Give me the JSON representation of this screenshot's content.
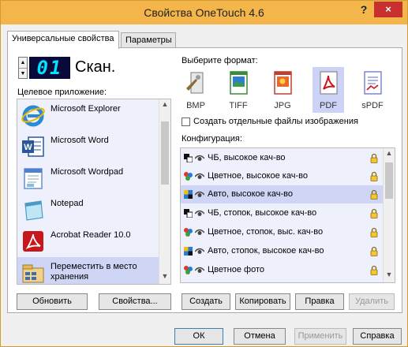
{
  "window": {
    "title": "Свойства OneTouch 4.6",
    "help": "?",
    "close": "×"
  },
  "tabs": [
    {
      "label": "Универсальные свойства"
    },
    {
      "label": "Параметры"
    }
  ],
  "left": {
    "button_number": "01",
    "button_name": "Скан.",
    "target_label": "Целевое приложение:",
    "apps": [
      {
        "name": "Microsoft Explorer",
        "icon": "internet-explorer-icon"
      },
      {
        "name": "Microsoft Word",
        "icon": "word-icon"
      },
      {
        "name": "Microsoft Wordpad",
        "icon": "wordpad-icon"
      },
      {
        "name": "Notepad",
        "icon": "notepad-icon"
      },
      {
        "name": "Acrobat Reader 10.0",
        "icon": "acrobat-icon"
      },
      {
        "name": "Переместить в место хранения",
        "icon": "storage-icon"
      }
    ],
    "refresh_label": "Обновить",
    "properties_label": "Свойства..."
  },
  "right": {
    "format_label": "Выберите формат:",
    "formats": [
      {
        "label": "BMP"
      },
      {
        "label": "TIFF"
      },
      {
        "label": "JPG"
      },
      {
        "label": "PDF"
      },
      {
        "label": "sPDF"
      }
    ],
    "separate_files_label": "Создать отдельные файлы изображения",
    "config_label": "Конфигурация:",
    "configs": [
      {
        "text": "ЧБ, высокое кач-во"
      },
      {
        "text": "Цветное, высокое кач-во"
      },
      {
        "text": "Авто, высокое кач-во"
      },
      {
        "text": "ЧБ, стопок, высокое кач-во"
      },
      {
        "text": "Цветное, стопок, выс. кач-во"
      },
      {
        "text": "Авто, стопок, высокое кач-во"
      },
      {
        "text": "Цветное фото"
      }
    ],
    "create_label": "Создать",
    "copy_label": "Копировать",
    "edit_label": "Правка",
    "delete_label": "Удалить"
  },
  "footer": {
    "ok_label": "ОК",
    "cancel_label": "Отмена",
    "apply_label": "Применить",
    "help_label": "Справка"
  },
  "colors": {
    "title_bar": "#f4b64b",
    "selection": "#cfd6f5",
    "close_button": "#c7302c",
    "led_text": "#00e5ff"
  }
}
